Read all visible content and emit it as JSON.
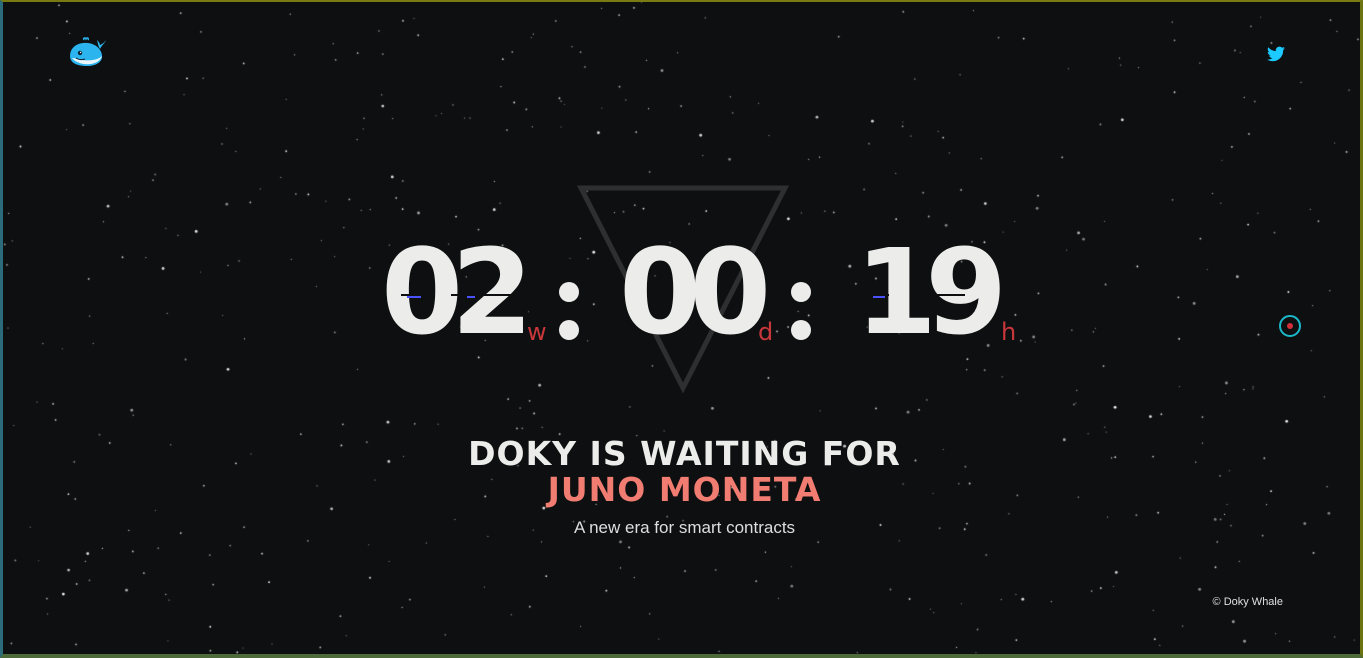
{
  "header": {
    "logo_icon": "whale-logo-icon",
    "twitter_icon": "twitter-icon"
  },
  "countdown": {
    "weeks": "02",
    "weeks_unit": "w",
    "days": "00",
    "days_unit": "d",
    "hours": "19",
    "hours_unit": "h",
    "separator_icon": "colon-dots"
  },
  "headline": "DOKY IS WAITING FOR",
  "project_name": "JUNO MONETA",
  "tagline": "A new era for smart contracts",
  "footer": {
    "copyright": "© Doky Whale"
  },
  "side_nav": {
    "dot_icon": "nav-dot-icon"
  },
  "colors": {
    "background": "#0d0f10",
    "text": "#ececea",
    "accent_coral": "#f07c72",
    "unit_red": "#c8373b",
    "teal": "#1ab9c9",
    "twitter": "#1dcaff"
  }
}
